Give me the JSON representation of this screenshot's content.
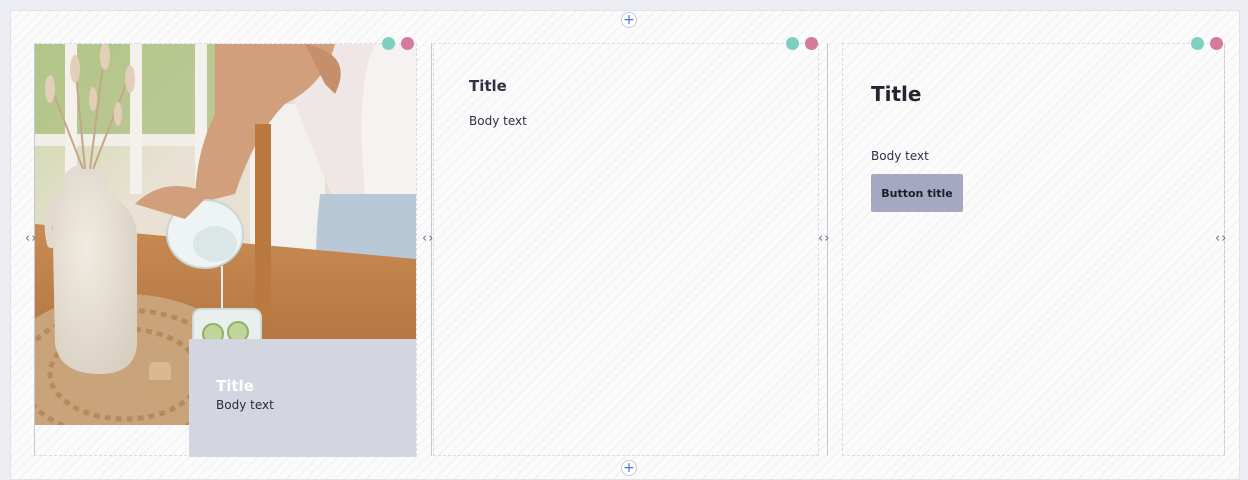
{
  "controls": {
    "add_symbol": "+",
    "nav_arrows": "‹›"
  },
  "status_dots": {
    "teal": "#7dd0c0",
    "pink": "#d47a9c"
  },
  "column1": {
    "image_alt": "Hand pouring water from a glass carafe into a glass with cucumber slices beside a white ceramic vase with dried pampas grass",
    "overlay_title": "Title",
    "overlay_body": "Body text"
  },
  "column2": {
    "title": "Title",
    "body": "Body text"
  },
  "column3": {
    "title": "Title",
    "body": "Body text",
    "button_label": "Button title"
  }
}
